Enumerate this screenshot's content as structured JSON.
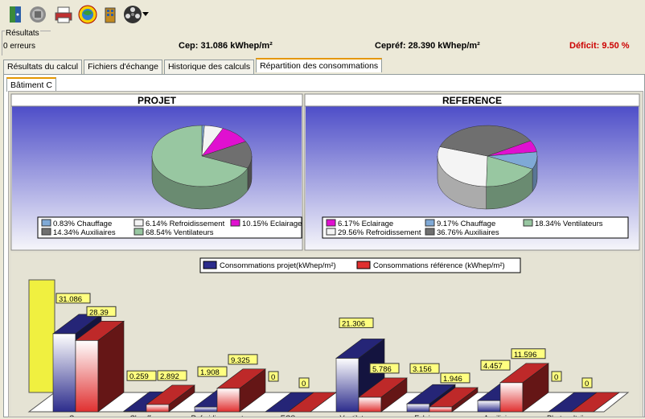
{
  "toolbar": {
    "icons": [
      "door-icon",
      "stop-icon",
      "print-icon",
      "globe-icon",
      "building-icon",
      "film-reel-icon",
      "dropdown-arrow-icon"
    ]
  },
  "status": {
    "results_label": "Résultats",
    "errors": "0 erreurs",
    "cep": "Cep: 31.086 kWhep/m²",
    "cepref": "Cepréf: 28.390 kWhep/m²",
    "deficit": "Déficit: 9.50 %",
    "deficit_color": "#cc0000"
  },
  "tabs": [
    "Résultats du calcul",
    "Fichiers d'échange",
    "Historique des calculs",
    "Répartition des consommations"
  ],
  "subtab": "Bâtiment C",
  "pies": [
    {
      "title": "PROJET",
      "slices": [
        {
          "label": "0.83% Chauffage",
          "value": 0.83,
          "color": "#7fa9d6"
        },
        {
          "label": "6.14% Refroidissement",
          "value": 6.14,
          "color": "#f4f4f4"
        },
        {
          "label": "10.15% Eclairage",
          "value": 10.15,
          "color": "#e010d0"
        },
        {
          "label": "14.34% Auxiliaires",
          "value": 14.34,
          "color": "#6f6f6f"
        },
        {
          "label": "68.54% Ventilateurs",
          "value": 68.54,
          "color": "#98c7a1"
        }
      ]
    },
    {
      "title": "REFERENCE",
      "slices": [
        {
          "label": "6.17% Eclairage",
          "value": 6.17,
          "color": "#e010d0"
        },
        {
          "label": "9.17% Chauffage",
          "value": 9.17,
          "color": "#7fa9d6"
        },
        {
          "label": "18.34% Ventilateurs",
          "value": 18.34,
          "color": "#98c7a1"
        },
        {
          "label": "29.56% Refroidissement",
          "value": 29.56,
          "color": "#f4f4f4"
        },
        {
          "label": "36.76% Auxiliaires",
          "value": 36.76,
          "color": "#6f6f6f"
        }
      ]
    }
  ],
  "bar_legend": {
    "projet": "Consommations projet(kWhep/m²)",
    "reference": "Consommations référence (kWhep/m²)",
    "projet_color": "#2c2c8c",
    "reference_color": "#e03030"
  },
  "chart_data": {
    "type": "bar",
    "categories": [
      "Cep",
      "Chauffage",
      "Refroidissement",
      "ECS",
      "Ventilateurs",
      "Eclairage",
      "Auxiliaires",
      "Photovoltaïque"
    ],
    "series": [
      {
        "name": "Consommations projet(kWhep/m²)",
        "values": [
          31.086,
          0.259,
          1.908,
          0,
          21.306,
          3.156,
          4.457,
          0
        ]
      },
      {
        "name": "Consommations référence (kWhep/m²)",
        "values": [
          28.39,
          2.892,
          9.325,
          0,
          5.786,
          1.946,
          11.596,
          0
        ]
      }
    ],
    "data_labels": [
      [
        "31.086",
        "0.259",
        "1.908",
        "0",
        "21.306",
        "3.156",
        "4.457",
        "0"
      ],
      [
        "28.39",
        "2.892",
        "9.325",
        "0",
        "5.786",
        "1.946",
        "11.596",
        "0"
      ]
    ],
    "legend": "top-center",
    "grid": false
  }
}
